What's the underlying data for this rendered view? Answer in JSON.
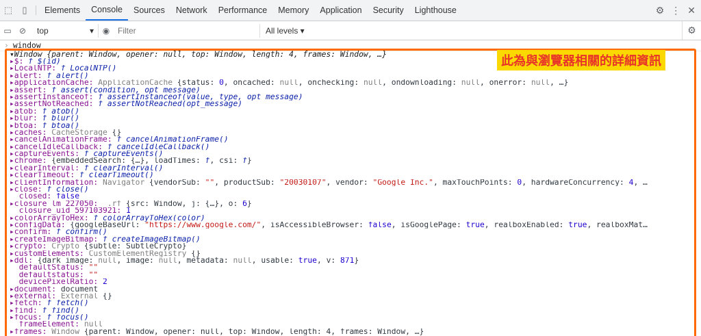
{
  "tabs": [
    "Elements",
    "Console",
    "Sources",
    "Network",
    "Performance",
    "Memory",
    "Application",
    "Security",
    "Lighthouse"
  ],
  "active_tab": "Console",
  "toolbar": {
    "context": "top",
    "filter_placeholder": "Filter",
    "levels": "All levels ▾"
  },
  "console_input": "window",
  "annotation": "此為與瀏覽器相關的詳細資訊",
  "window_header": "▾Window {parent: Window, opener: null, top: Window, length: 4, frames: Window, …}",
  "rows": [
    [
      [
        "k",
        "▸$: "
      ],
      [
        "f",
        "f $(id)"
      ]
    ],
    [
      [
        "k",
        "▸LocalNTP: "
      ],
      [
        "f",
        "f LocalNTP()"
      ]
    ],
    [
      [
        "k",
        "▸alert: "
      ],
      [
        "f",
        "f alert()"
      ]
    ],
    [
      [
        "k",
        "▸applicationCache: "
      ],
      [
        "g",
        "ApplicationCache "
      ],
      [
        "tx",
        "{status: "
      ],
      [
        "n",
        "0"
      ],
      [
        "tx",
        ", oncached: "
      ],
      [
        "g",
        "null"
      ],
      [
        "tx",
        ", onchecking: "
      ],
      [
        "g",
        "null"
      ],
      [
        "tx",
        ", ondownloading: "
      ],
      [
        "g",
        "null"
      ],
      [
        "tx",
        ", onerror: "
      ],
      [
        "g",
        "null"
      ],
      [
        "tx",
        ", …}"
      ]
    ],
    [
      [
        "k",
        "▸assert: "
      ],
      [
        "f",
        "f assert(condition, opt_message)"
      ]
    ],
    [
      [
        "k",
        "▸assertInstanceof: "
      ],
      [
        "f",
        "f assertInstanceof(value, type, opt_message)"
      ]
    ],
    [
      [
        "k",
        "▸assertNotReached: "
      ],
      [
        "f",
        "f assertNotReached(opt_message)"
      ]
    ],
    [
      [
        "k",
        "▸atob: "
      ],
      [
        "f",
        "f atob()"
      ]
    ],
    [
      [
        "k",
        "▸blur: "
      ],
      [
        "f",
        "f blur()"
      ]
    ],
    [
      [
        "k",
        "▸btoa: "
      ],
      [
        "f",
        "f btoa()"
      ]
    ],
    [
      [
        "k",
        "▸caches: "
      ],
      [
        "g",
        "CacheStorage "
      ],
      [
        "tx",
        "{}"
      ]
    ],
    [
      [
        "k",
        "▸cancelAnimationFrame: "
      ],
      [
        "f",
        "f cancelAnimationFrame()"
      ]
    ],
    [
      [
        "k",
        "▸cancelIdleCallback: "
      ],
      [
        "f",
        "f cancelIdleCallback()"
      ]
    ],
    [
      [
        "k",
        "▸captureEvents: "
      ],
      [
        "f",
        "f captureEvents()"
      ]
    ],
    [
      [
        "k",
        "▸chrome: "
      ],
      [
        "tx",
        "{embeddedSearch: {…}, loadTimes: "
      ],
      [
        "f",
        "f"
      ],
      [
        "tx",
        ", csi: "
      ],
      [
        "f",
        "f"
      ],
      [
        "tx",
        "}"
      ]
    ],
    [
      [
        "k",
        "▸clearInterval: "
      ],
      [
        "f",
        "f clearInterval()"
      ]
    ],
    [
      [
        "k",
        "▸clearTimeout: "
      ],
      [
        "f",
        "f clearTimeout()"
      ]
    ],
    [
      [
        "k",
        "▸clientInformation: "
      ],
      [
        "g",
        "Navigator "
      ],
      [
        "tx",
        "{vendorSub: "
      ],
      [
        "s",
        "\"\""
      ],
      [
        "tx",
        ", productSub: "
      ],
      [
        "s",
        "\"20030107\""
      ],
      [
        "tx",
        ", vendor: "
      ],
      [
        "s",
        "\"Google Inc.\""
      ],
      [
        "tx",
        ", maxTouchPoints: "
      ],
      [
        "n",
        "0"
      ],
      [
        "tx",
        ", hardwareConcurrency: "
      ],
      [
        "n",
        "4"
      ],
      [
        "tx",
        ", …"
      ]
    ],
    [
      [
        "k",
        "▸close: "
      ],
      [
        "f",
        "f close()"
      ]
    ],
    [
      [
        "k",
        "  closed: "
      ],
      [
        "n",
        "false"
      ]
    ],
    [
      [
        "k",
        "▸closure_lm_227050: "
      ],
      [
        "g",
        "_.rf "
      ],
      [
        "tx",
        "{src: Window, j: {…}, o: "
      ],
      [
        "n",
        "6"
      ],
      [
        "tx",
        "}"
      ]
    ],
    [
      [
        "k",
        "  closure_uid_597103921: "
      ],
      [
        "n",
        "1"
      ]
    ],
    [
      [
        "k",
        "▸colorArrayToHex: "
      ],
      [
        "f",
        "f colorArrayToHex(color)"
      ]
    ],
    [
      [
        "k",
        "▸configData: "
      ],
      [
        "tx",
        "{googleBaseUrl: "
      ],
      [
        "s",
        "\"https://www.google.com/\""
      ],
      [
        "tx",
        ", isAccessibleBrowser: "
      ],
      [
        "n",
        "false"
      ],
      [
        "tx",
        ", isGooglePage: "
      ],
      [
        "n",
        "true"
      ],
      [
        "tx",
        ", realboxEnabled: "
      ],
      [
        "n",
        "true"
      ],
      [
        "tx",
        ", realboxMat…"
      ]
    ],
    [
      [
        "k",
        "▸confirm: "
      ],
      [
        "f",
        "f confirm()"
      ]
    ],
    [
      [
        "k",
        "▸createImageBitmap: "
      ],
      [
        "f",
        "f createImageBitmap()"
      ]
    ],
    [
      [
        "k",
        "▸crypto: "
      ],
      [
        "g",
        "Crypto "
      ],
      [
        "tx",
        "{subtle: SubtleCrypto}"
      ]
    ],
    [
      [
        "k",
        "▸customElements: "
      ],
      [
        "g",
        "CustomElementRegistry "
      ],
      [
        "tx",
        "{}"
      ]
    ],
    [
      [
        "k",
        "▸ddl: "
      ],
      [
        "tx",
        "{dark_image: "
      ],
      [
        "g",
        "null"
      ],
      [
        "tx",
        ", image: "
      ],
      [
        "g",
        "null"
      ],
      [
        "tx",
        ", metadata: "
      ],
      [
        "g",
        "null"
      ],
      [
        "tx",
        ", usable: "
      ],
      [
        "n",
        "true"
      ],
      [
        "tx",
        ", v: "
      ],
      [
        "n",
        "871"
      ],
      [
        "tx",
        "}"
      ]
    ],
    [
      [
        "k",
        "  defaultStatus: "
      ],
      [
        "s",
        "\"\""
      ]
    ],
    [
      [
        "k",
        "  defaultstatus: "
      ],
      [
        "s",
        "\"\""
      ]
    ],
    [
      [
        "k",
        "  devicePixelRatio: "
      ],
      [
        "n",
        "2"
      ]
    ],
    [
      [
        "k",
        "▸document: "
      ],
      [
        "tx",
        "document"
      ]
    ],
    [
      [
        "k",
        "▸external: "
      ],
      [
        "g",
        "External "
      ],
      [
        "tx",
        "{}"
      ]
    ],
    [
      [
        "k",
        "▸fetch: "
      ],
      [
        "f",
        "f fetch()"
      ]
    ],
    [
      [
        "k",
        "▸find: "
      ],
      [
        "f",
        "f find()"
      ]
    ],
    [
      [
        "k",
        "▸focus: "
      ],
      [
        "f",
        "f focus()"
      ]
    ],
    [
      [
        "k",
        "  frameElement: "
      ],
      [
        "g",
        "null"
      ]
    ],
    [
      [
        "k",
        "▸frames: "
      ],
      [
        "g",
        "Window "
      ],
      [
        "tx",
        "{parent: Window, opener: null, top: Window, length: 4, frames: Window, …}"
      ]
    ]
  ]
}
